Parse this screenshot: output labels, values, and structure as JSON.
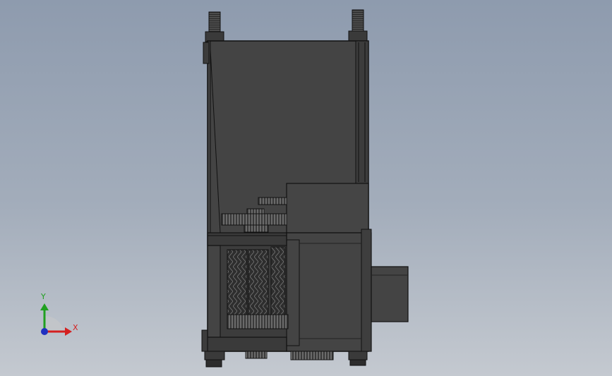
{
  "viewport": {
    "background_top": "#8e9bae",
    "background_bottom": "#c4c9d0",
    "body_color": "#454545",
    "edge_color": "#1a1a1a"
  },
  "triad": {
    "x_label": "X",
    "y_label": "Y",
    "x_color": "#d42020",
    "y_color": "#20a020",
    "z_color": "#2030c0"
  }
}
